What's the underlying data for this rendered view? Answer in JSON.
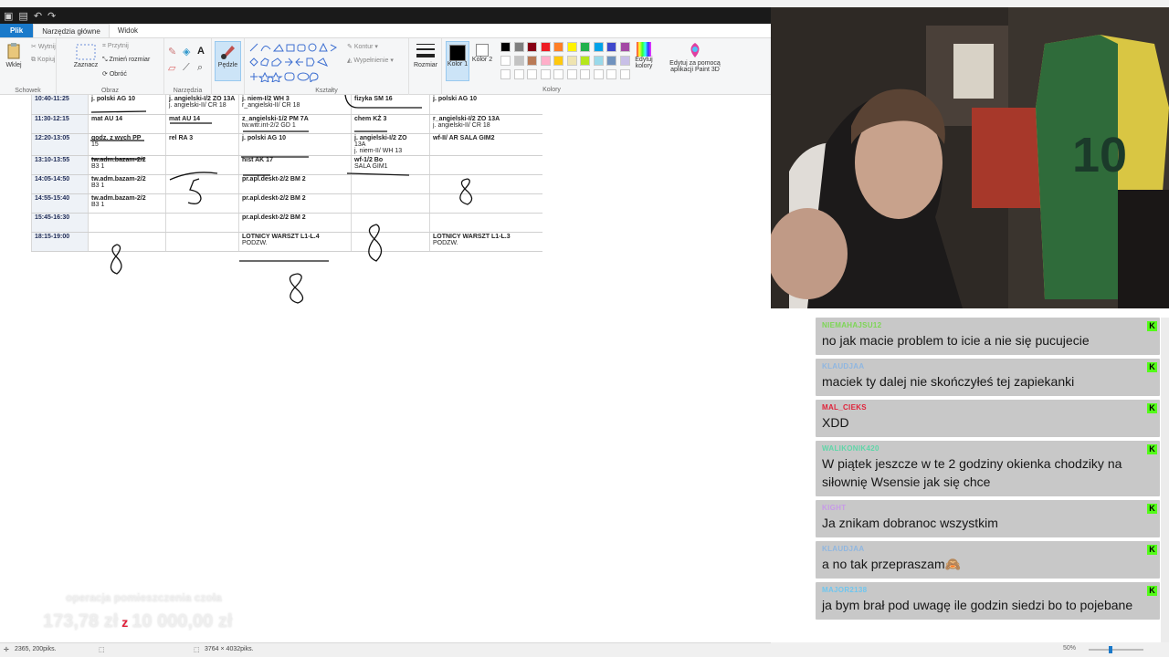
{
  "paint": {
    "menu": {
      "file": "Plik",
      "home": "Narzędzia główne",
      "view": "Widok"
    },
    "ribbon": {
      "clipboard": {
        "paste": "Wklej",
        "cut": "Wytnij",
        "copy": "Kopiuj",
        "label": "Schowek"
      },
      "image": {
        "select": "Zaznacz",
        "crop": "Przytnij",
        "resize": "Zmień rozmiar",
        "rotate": "Obróć",
        "label": "Obraz"
      },
      "tools": {
        "label": "Narzędzia"
      },
      "brushes": {
        "label": "Pędzle"
      },
      "shapes": {
        "outline": "Kontur",
        "fill": "Wypełnienie",
        "label": "Kształty"
      },
      "size": {
        "label": "Rozmiar"
      },
      "color1": "Kolor 1",
      "color2": "Kolor 2",
      "edit_colors": "Edytuj kolory",
      "paint3d": "Edytuj za pomocą aplikacji Paint 3D",
      "colors_label": "Kolory"
    },
    "palette": [
      "#000000",
      "#7f7f7f",
      "#880015",
      "#ed1c24",
      "#ff7f27",
      "#fff200",
      "#22b14c",
      "#00a2e8",
      "#3f48cc",
      "#a349a4",
      "#ffffff",
      "#c3c3c3",
      "#b97a57",
      "#ffaec9",
      "#ffc90e",
      "#efe4b0",
      "#b5e61d",
      "#99d9ea",
      "#7092be",
      "#c8bfe7"
    ],
    "status": {
      "position": "2365, 200piks.",
      "size": "3764 × 4032piks.",
      "zoom": "50%"
    }
  },
  "schedule": [
    {
      "time": "10:40-11:25",
      "c1": [
        "j. polski AG 10"
      ],
      "c2": [
        "j. angielski-I/2 ZO 13A",
        "j. angielski-II/ CR 18"
      ],
      "c3": [
        "j. niem-I/2 WH 3",
        "r_angielski-II/ CR 18"
      ],
      "c4": [
        "fizyka SM 16"
      ],
      "c5": [
        "j. polski AG 10"
      ]
    },
    {
      "time": "11:30-12:15",
      "c1": [
        "mat AU 14"
      ],
      "c2": [
        "mat AU 14"
      ],
      "c3": [
        "z_angielski-1/2 PM 7A",
        "tw.witr.int-2/2 GD 1"
      ],
      "c4": [
        "chem KŻ 3"
      ],
      "c5": [
        "r_angielski-I/2 ZO 13A",
        "j. angielski-II/ CR 18"
      ]
    },
    {
      "time": "12:20-13:05",
      "c1": [
        "godz. z wych PP",
        "15"
      ],
      "c2": [
        "rel RA 3"
      ],
      "c3": [
        "j. polski AG 10"
      ],
      "c4": [
        "j. angielski-I/2 ZO",
        "13A",
        "j. niem-II/ WH 13"
      ],
      "c5": [
        "wf-II/ AR SALA GIM2"
      ]
    },
    {
      "time": "13:10-13:55",
      "c1": [
        "tw.adm.bazam-2/2",
        "B3 1"
      ],
      "c2": [],
      "c3": [
        "hist AK 17"
      ],
      "c4": [
        "wf-1/2 Bo",
        "SALA GIM1"
      ],
      "c5": []
    },
    {
      "time": "14:05-14:50",
      "c1": [
        "tw.adm.bazam-2/2",
        "B3 1"
      ],
      "c2": [],
      "c3": [
        "pr.apl.deskt-2/2 BM 2"
      ],
      "c4": [],
      "c5": []
    },
    {
      "time": "14:55-15:40",
      "c1": [
        "tw.adm.bazam-2/2",
        "B3 1"
      ],
      "c2": [],
      "c3": [
        "pr.apl.deskt-2/2 BM 2"
      ],
      "c4": [],
      "c5": []
    },
    {
      "time": "15:45-16:30",
      "c1": [],
      "c2": [],
      "c3": [
        "pr.apl.deskt-2/2 BM 2"
      ],
      "c4": [],
      "c5": []
    },
    {
      "time": "18:15-19:00",
      "c1": [],
      "c2": [],
      "c3": [
        "LOTNICY WARSZT L1-L.4",
        "PODZW."
      ],
      "c4": [],
      "c5": [
        "LOTNICY WARSZT L1-L.3",
        "PODZW."
      ]
    }
  ],
  "donation": {
    "label": "operacja pomieszczenia czoła",
    "current": "173,78 zł",
    "sep": "z",
    "goal": "10 000,00 zł"
  },
  "chat": [
    {
      "user": "NIEMAHAJSU12",
      "color": "#7cd655",
      "text": "no jak macie problem to icie a nie się pucujecie"
    },
    {
      "user": "KLAUDJAA",
      "color": "#8fb6e0",
      "text": "maciek ty dalej nie skończyłeś tej zapiekanki"
    },
    {
      "user": "MAL_CIEKS",
      "color": "#e0233a",
      "text": "XDD"
    },
    {
      "user": "WALIKONIK420",
      "color": "#5fd6a8",
      "text": "W piątek jeszcze w te 2 godziny okienka chodziky na siłownię Wsensie jak się chce"
    },
    {
      "user": "KIGHT",
      "color": "#c79ae8",
      "text": "Ja znikam dobranoc wszystkim"
    },
    {
      "user": "KLAUDJAA",
      "color": "#8fb6e0",
      "text": "a no tak przepraszam🙈"
    },
    {
      "user": "MAJOR2138",
      "color": "#6fc6ef",
      "text": "ja bym brał pod uwagę ile godzin siedzi bo to pojebane"
    }
  ]
}
